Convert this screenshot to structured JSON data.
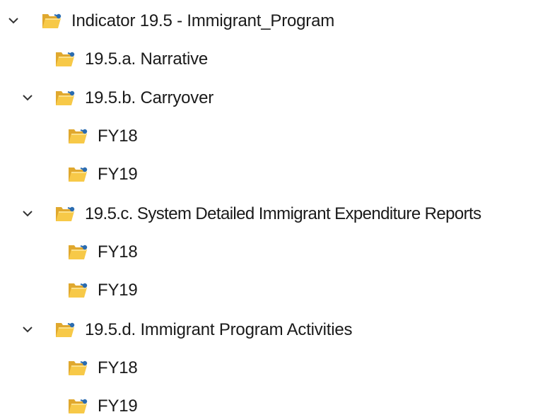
{
  "tree": {
    "root": {
      "label": "Indicator 19.5 - Immigrant_Program",
      "expanded": true,
      "icon": "shared-folder-icon"
    },
    "nodes": [
      {
        "label": "19.5.a. Narrative",
        "expanded": false,
        "has_children": false
      },
      {
        "label": "19.5.b. Carryover",
        "expanded": true,
        "has_children": true,
        "children": [
          {
            "label": "FY18"
          },
          {
            "label": "FY19"
          }
        ]
      },
      {
        "label": "19.5.c. System Detailed Immigrant Expenditure Reports",
        "expanded": true,
        "has_children": true,
        "children": [
          {
            "label": "FY18"
          },
          {
            "label": "FY19"
          }
        ]
      },
      {
        "label": "19.5.d. Immigrant Program Activities",
        "expanded": true,
        "has_children": true,
        "children": [
          {
            "label": "FY18"
          },
          {
            "label": "FY19"
          }
        ]
      }
    ]
  },
  "colors": {
    "folder_front": "#f7c948",
    "folder_back": "#e0a82e",
    "folder_highlight": "#fde7a0",
    "share_badge": "#2b6cb0",
    "chevron": "#333333",
    "text": "#1a1a1a"
  }
}
